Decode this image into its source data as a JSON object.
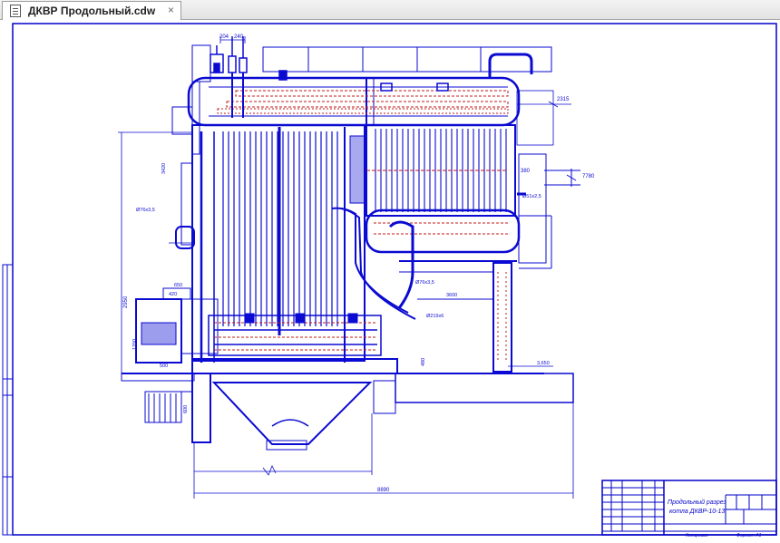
{
  "tab": {
    "title": "ДКВР Продольный.cdw",
    "close_glyph": "×",
    "icon": "document-icon"
  },
  "dimensions": {
    "d204": "204",
    "d240": "240",
    "d2315": "2315",
    "d380": "380",
    "d7780": "7780",
    "d3420": "3420",
    "d480": "480",
    "d500": "500",
    "d2000": "2000",
    "d650": "650",
    "d3600": "3600",
    "d8890": "8890",
    "d3650": "3,650",
    "d420": "420",
    "d1200": "1200",
    "d1250": "1250",
    "d2950": "2950",
    "d600": "600",
    "d510": "510",
    "d4200": "4200",
    "d880": "880"
  },
  "callouts": {
    "pipe1": "Ø76х3,5",
    "pipe2": "Ø51х2,5",
    "pipe3": "Ø76х3,5",
    "pipe4": "Ø219х6"
  },
  "title_block": {
    "title_line1": "Продольный разрез",
    "title_line2": "котла ДКВР-10-13",
    "copied": "Копировал",
    "format": "Формат А1"
  },
  "colors": {
    "drawing": "#0a0ad2",
    "hatching": "#c01818",
    "frame": "#0000c8"
  }
}
